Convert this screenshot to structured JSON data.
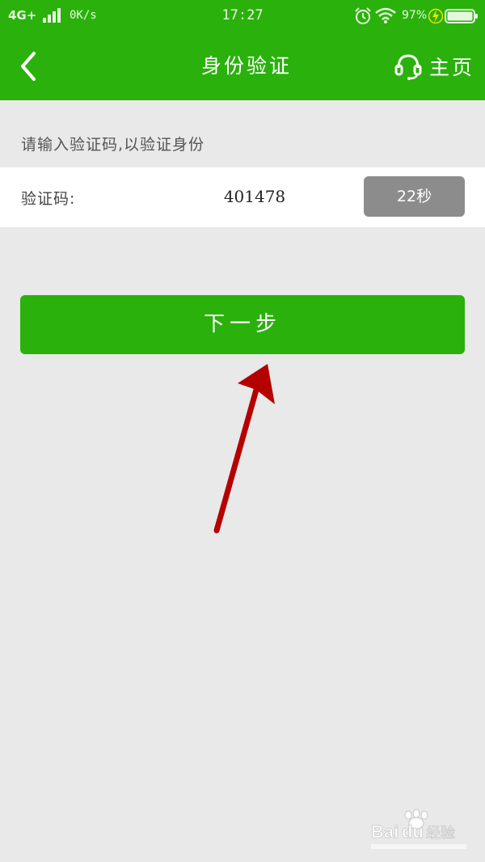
{
  "status_bar": {
    "network": "4G+",
    "speed": "0K/s",
    "time": "17:27",
    "battery_percent": "97%"
  },
  "header": {
    "title": "身份验证",
    "home_label": "主页"
  },
  "verify": {
    "hint": "请输入验证码,以验证身份",
    "code_label": "验证码:",
    "code_value": "401478",
    "countdown": "22秒"
  },
  "next_button": {
    "label": "下一步"
  },
  "colors": {
    "brand_green": "#2ab10c",
    "page_bg": "#e8e9e8",
    "countdown_bg": "#8c8c8c",
    "annotation_red": "#b50000"
  },
  "icons": {
    "back": "chevron-left-icon",
    "support": "headset-icon",
    "alarm": "alarm-clock-icon",
    "wifi": "wifi-icon",
    "charge": "lightning-icon",
    "battery": "battery-icon",
    "signal": "signal-bars-icon"
  }
}
